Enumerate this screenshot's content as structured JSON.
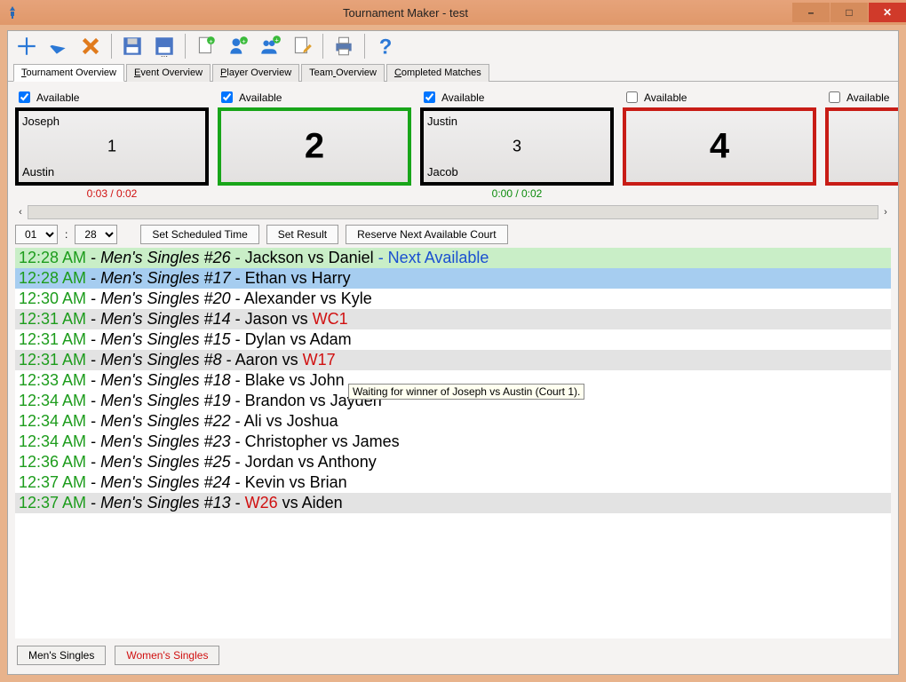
{
  "window_title": "Tournament Maker - test",
  "titlebar_buttons": {
    "min": "–",
    "max": "□",
    "close": "✕"
  },
  "toolbar_icons": [
    {
      "name": "new-icon",
      "sep": false
    },
    {
      "name": "open-icon",
      "sep": false
    },
    {
      "name": "delete-icon",
      "sep": true
    },
    {
      "name": "save-icon",
      "sep": false
    },
    {
      "name": "save-as-icon",
      "sep": true
    },
    {
      "name": "new-doc-icon",
      "sep": false
    },
    {
      "name": "add-player-icon",
      "sep": false
    },
    {
      "name": "add-team-icon",
      "sep": false
    },
    {
      "name": "edit-doc-icon",
      "sep": true
    },
    {
      "name": "print-icon",
      "sep": true
    },
    {
      "name": "help-icon",
      "sep": false
    }
  ],
  "tabs": [
    {
      "label": "Tournament Overview",
      "hotkey_idx": 0,
      "active": true
    },
    {
      "label": "Event Overview",
      "hotkey_idx": 0,
      "active": false
    },
    {
      "label": "Player Overview",
      "hotkey_idx": 0,
      "active": false
    },
    {
      "label": "Team Overview",
      "hotkey_idx": 4,
      "active": false
    },
    {
      "label": "Completed Matches",
      "hotkey_idx": 0,
      "active": false
    }
  ],
  "available_label": "Available",
  "courts": [
    {
      "available": true,
      "border": "black",
      "big": false,
      "p1": "Joseph",
      "p2": "Austin",
      "num": "1",
      "time": "0:03 / 0:02",
      "time_color": "red"
    },
    {
      "available": true,
      "border": "green",
      "big": true,
      "p1": "",
      "p2": "",
      "num": "2",
      "time": "",
      "time_color": ""
    },
    {
      "available": true,
      "border": "black",
      "big": false,
      "p1": "Justin",
      "p2": "Jacob",
      "num": "3",
      "time": "0:00 / 0:02",
      "time_color": "green"
    },
    {
      "available": false,
      "border": "red",
      "big": true,
      "p1": "",
      "p2": "",
      "num": "4",
      "time": "",
      "time_color": ""
    },
    {
      "available": false,
      "border": "red",
      "big": true,
      "p1": "",
      "p2": "",
      "num": "",
      "time": "",
      "time_color": ""
    }
  ],
  "time_select": {
    "hour": "01",
    "sep": ":",
    "minute": "28"
  },
  "buttons": {
    "set_scheduled": "Set Scheduled Time",
    "set_result": "Set Result",
    "reserve": "Reserve Next Available Court"
  },
  "matches": [
    {
      "bg": "bg-green",
      "time": "12:28 AM",
      "event": "Men's Singles #26",
      "a_red": false,
      "a": "Jackson",
      "b_red": false,
      "b": "Daniel",
      "suffix": " - Next Available",
      "suffix_class": "txt-blue"
    },
    {
      "bg": "bg-blue",
      "time": "12:28 AM",
      "event": "Men's Singles #17",
      "a_red": false,
      "a": "Ethan",
      "b_red": false,
      "b": "Harry",
      "suffix": "",
      "suffix_class": ""
    },
    {
      "bg": "bg-white",
      "time": "12:30 AM",
      "event": "Men's Singles #20",
      "a_red": false,
      "a": "Alexander",
      "b_red": false,
      "b": "Kyle",
      "suffix": "",
      "suffix_class": ""
    },
    {
      "bg": "bg-gray",
      "time": "12:31 AM",
      "event": "Men's Singles #14",
      "a_red": false,
      "a": "Jason",
      "b_red": true,
      "b": "WC1",
      "suffix": "",
      "suffix_class": ""
    },
    {
      "bg": "bg-white",
      "time": "12:31 AM",
      "event": "Men's Singles #15",
      "a_red": false,
      "a": "Dylan",
      "b_red": false,
      "b": "Adam",
      "suffix": "",
      "suffix_class": ""
    },
    {
      "bg": "bg-gray",
      "time": "12:31 AM",
      "event": "Men's Singles #8",
      "a_red": false,
      "a": "Aaron",
      "b_red": true,
      "b": "W17",
      "suffix": "",
      "suffix_class": ""
    },
    {
      "bg": "bg-white",
      "time": "12:33 AM",
      "event": "Men's Singles #18",
      "a_red": false,
      "a": "Blake",
      "b_red": false,
      "b": "John",
      "suffix": "",
      "suffix_class": ""
    },
    {
      "bg": "bg-white",
      "time": "12:34 AM",
      "event": "Men's Singles #19",
      "a_red": false,
      "a": "Brandon",
      "b_red": false,
      "b": "Jayden",
      "suffix": "",
      "suffix_class": ""
    },
    {
      "bg": "bg-white",
      "time": "12:34 AM",
      "event": "Men's Singles #22",
      "a_red": false,
      "a": "Ali",
      "b_red": false,
      "b": "Joshua",
      "suffix": "",
      "suffix_class": ""
    },
    {
      "bg": "bg-white",
      "time": "12:34 AM",
      "event": "Men's Singles #23",
      "a_red": false,
      "a": "Christopher",
      "b_red": false,
      "b": "James",
      "suffix": "",
      "suffix_class": ""
    },
    {
      "bg": "bg-white",
      "time": "12:36 AM",
      "event": "Men's Singles #25",
      "a_red": false,
      "a": "Jordan",
      "b_red": false,
      "b": "Anthony",
      "suffix": "",
      "suffix_class": ""
    },
    {
      "bg": "bg-white",
      "time": "12:37 AM",
      "event": "Men's Singles #24",
      "a_red": false,
      "a": "Kevin",
      "b_red": false,
      "b": "Brian",
      "suffix": "",
      "suffix_class": ""
    },
    {
      "bg": "bg-gray",
      "time": "12:37 AM",
      "event": "Men's Singles #13",
      "a_red": true,
      "a": "W26",
      "b_red": false,
      "b": "Aiden",
      "suffix": "",
      "suffix_class": ""
    }
  ],
  "tooltip": "Waiting for winner of Joseph vs Austin (Court 1).",
  "categories": [
    {
      "label": "Men's Singles",
      "class": ""
    },
    {
      "label": "Women's Singles",
      "class": "red"
    }
  ]
}
